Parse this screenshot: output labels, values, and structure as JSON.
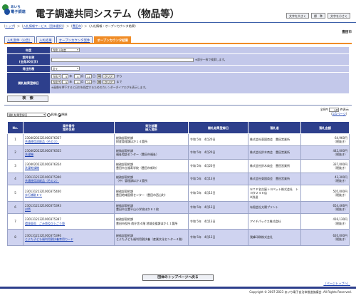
{
  "header": {
    "logo_line1": "あいち",
    "logo_line2": "電子調達",
    "app_title": "電子調達共同システム（物品等）",
    "size_buttons": [
      "文字を大きく",
      "標　準",
      "文字を小さく"
    ]
  },
  "breadcrumb": {
    "items": [
      "トップ",
      "入札情報サービス（団体選択）",
      "豊田市"
    ],
    "current": "入札情報 : オープンカウンタ結果",
    "sep": " > "
  },
  "org_name": "豊田市",
  "tabs": [
    "入札案件（公告）",
    "入札結果",
    "オープンカウンタ案件",
    "オープンカウンタ結果"
  ],
  "form": {
    "labels": {
      "year": "年度",
      "case_name": "案件名称",
      "case_name_sub": "(全角30文字)",
      "order_type": "発注形態",
      "open_date": "開札結果登録日"
    },
    "year_value": "令和 5年度",
    "case_name_note": "※部分一致で検索します。",
    "order_type_value": "全て",
    "from": {
      "era": "令和",
      "year": "5",
      "month": "4",
      "day": "11"
    },
    "to": {
      "era": "令和",
      "year": "5",
      "month": "4",
      "day": "20"
    },
    "u_year": "年",
    "u_month": "月",
    "u_day": "日",
    "clear": "クリア",
    "kara": "から",
    "made": "まで",
    "cal_note": "※画像を押下すると日付を指定するためのカレンダーダイアログを表示します。"
  },
  "search_button": "検　索",
  "sort": {
    "select_value": "開札結果登録日",
    "asc": "昇順",
    "desc": "降順"
  },
  "paging": {
    "total": "全8件",
    "per_page_label": "件表示",
    "per_page_value": "50",
    "pages": "1/1ページ"
  },
  "table": {
    "headers": {
      "no": "No.",
      "case": "案件番号\n案件名称",
      "dept": "発注部署\n納入場所",
      "date": "開札結果登録日",
      "vendor": "落札者",
      "amount": "落札金額"
    },
    "rows": [
      {
        "no": "1",
        "id": "23040202321000376357",
        "name": "共通使用消耗品（その３）",
        "dept": "総務部契約課",
        "place": "財産管理課ほか１４箇所",
        "date": "令和 5年　4月20日",
        "vendor": "株式会社東国商会　豊田営業所",
        "vendor2": "",
        "amount": "64,960円",
        "tax": "（税抜き）",
        "extra": ""
      },
      {
        "no": "2",
        "id": "23040202321000376355",
        "name": "洗濯機",
        "dept": "総務部契約課",
        "place": "福祉相談センター（豊田市福祉）",
        "date": "令和 5年　4月20日",
        "vendor": "株式会社鈴木商会　豊田営業所",
        "vendor2": "",
        "amount": "442,000円",
        "tax": "（税抜き）",
        "extra": ""
      },
      {
        "no": "3",
        "id": "23040202321000376354",
        "name": "洗濯乾燥機",
        "dept": "総務部契約課",
        "place": "豊田市立福寿学校（豊田市新町）",
        "date": "令和 5年　4月20日",
        "vendor": "株式会社鈴木商会　豊田営業所",
        "vendor2": "",
        "amount": "337,000円",
        "tax": "（税抜き）",
        "extra": ""
      },
      {
        "no": "4",
        "id": "23013121321000375300",
        "name": "共通使用消耗品（その２）",
        "dept": "総務部契約課",
        "place": "（中）管理課ほか３箇所",
        "date": "令和 5年　4月13日",
        "vendor": "株式会社東国商会　豊田営業所",
        "vendor2": "",
        "amount": "43,300円",
        "tax": "（税抜き）",
        "extra": ""
      },
      {
        "no": "5",
        "id": "23013121321000375400",
        "name": "歩行補助ＥＶ",
        "dept": "総務部契約課",
        "place": "豊田地域医療センター（豊田市西山町）",
        "date": "令和 5年　4月13日",
        "vendor": "ＮＴＰ名古屋トヨペット株式会社　トヨタ２４８店",
        "vendor2": "",
        "amount": "505,000円",
        "tax": "（税抜き）",
        "extra": "※辞退"
      },
      {
        "no": "6",
        "id": "23013121321000375393",
        "name": "封筒",
        "dept": "総務部契約課",
        "place": "豊田市立豊平山小学校ほか８１校",
        "date": "令和 5年　4月13日",
        "vendor": "有限会社太陽プリント",
        "vendor2": "",
        "amount": "654,466円",
        "tax": "（税抜き）",
        "extra": ""
      },
      {
        "no": "7",
        "id": "23013121321000375397",
        "name": "環境車両　ごみ袋及び上ごう袋",
        "dept": "総務部契約課",
        "place": "豊田市役所 南庁舎４階 地域支援課ほか１１箇所",
        "date": "令和 5年　4月13日",
        "vendor": "アイチパックス株式会社",
        "vendor2": "",
        "amount": "416,130円",
        "tax": "（税抜き）",
        "extra": ""
      },
      {
        "no": "8",
        "id": "23013121321000375396",
        "name": "とよた子ども福利用割扶養育用カード",
        "dept": "総務部契約課",
        "place": "とよた子ども福利用割扶養（産業文化センター４階）",
        "date": "令和 5年　4月13日",
        "vendor": "我峰印刷株式会社",
        "vendor2": "",
        "amount": "620,000円",
        "tax": "（税抜き）",
        "extra": ""
      }
    ]
  },
  "back_button": "団体のトップページへ戻る",
  "page_top": "ページトップへ",
  "footer": "Copyright © 2007-2023 あいち電子自治体推進協議会. All Rights Reserved."
}
